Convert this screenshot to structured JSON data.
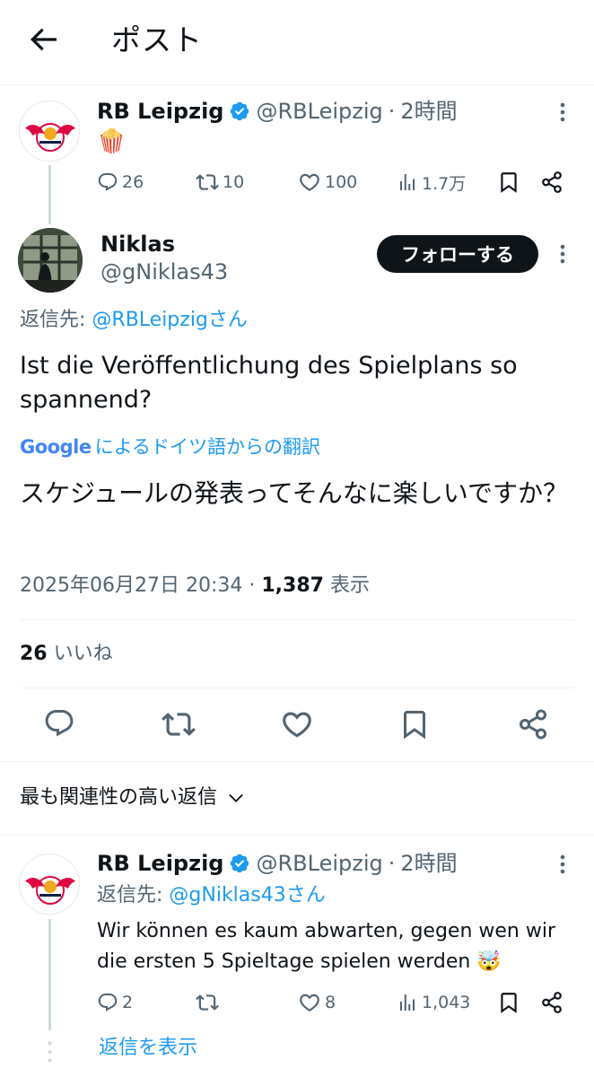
{
  "header": {
    "title": "ポスト"
  },
  "parent_post": {
    "author_name": "RB Leipzig",
    "handle": "@RBLeipzig",
    "separator": "·",
    "time": "2時間",
    "emoji": "🍿",
    "replies": "26",
    "reposts": "10",
    "likes": "100",
    "views": "1.7万"
  },
  "main_post": {
    "author_name": "Niklas",
    "handle": "@gNiklas43",
    "follow_label": "フォローする",
    "reply_to_prefix": "返信先: ",
    "reply_to_user": "@RBLeipzigさん",
    "text": "Ist die Veröffentlichung des Spielplans so spannend?",
    "translation_brand": "Google",
    "translation_label": "によるドイツ語からの翻訳",
    "translated_text": "スケジュールの発表ってそんなに楽しいですか？",
    "timestamp": "2025年06月27日 20:34",
    "separator": "·",
    "views_count": "1,387",
    "views_label": "表示",
    "likes_count": "26",
    "likes_label": "いいね"
  },
  "sort": {
    "label": "最も関連性の高い返信"
  },
  "reply_post": {
    "author_name": "RB Leipzig",
    "handle": "@RBLeipzig",
    "separator": "·",
    "time": "2時間",
    "reply_to_prefix": "返信先: ",
    "reply_to_user": "@gNiklas43さん",
    "text": "Wir können es kaum abwarten, gegen wen wir die ersten 5 Spieltage spielen werden 🤯",
    "replies": "2",
    "reposts": "",
    "likes": "8",
    "views": "1,043",
    "show_replies": "返信を表示"
  },
  "colors": {
    "accent": "#1d9bf0",
    "text": "#0f1419",
    "secondary": "#536471",
    "rb_red": "#dd0741",
    "rb_gold": "#f0a81d"
  }
}
